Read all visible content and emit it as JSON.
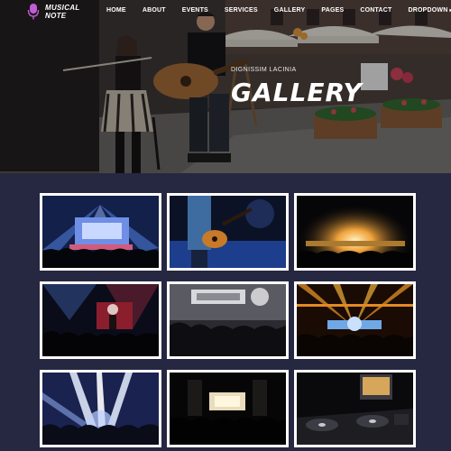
{
  "brand": {
    "name": "MUSICAL NOTE",
    "icon": "microphone-icon",
    "accent": "#c25bd6"
  },
  "nav": {
    "items": [
      {
        "label": "HOME"
      },
      {
        "label": "ABOUT"
      },
      {
        "label": "EVENTS"
      },
      {
        "label": "SERVICES"
      },
      {
        "label": "GALLERY"
      },
      {
        "label": "PAGES"
      },
      {
        "label": "CONTACT"
      },
      {
        "label": "DROPDOWN"
      }
    ]
  },
  "hero": {
    "kicker": "DIGNISSIM LACINIA",
    "title": "GALLERY"
  },
  "gallery": {
    "background": "#262842",
    "photos": [
      {
        "subject": "concert-stage-blue-lights"
      },
      {
        "subject": "guitarist-closeup"
      },
      {
        "subject": "stage-golden-glow"
      },
      {
        "subject": "crowd-red-stage"
      },
      {
        "subject": "crowd-smoke-stage"
      },
      {
        "subject": "orange-laser-show"
      },
      {
        "subject": "white-beam-lights"
      },
      {
        "subject": "dark-hall-stage"
      },
      {
        "subject": "dj-turntables"
      }
    ]
  }
}
